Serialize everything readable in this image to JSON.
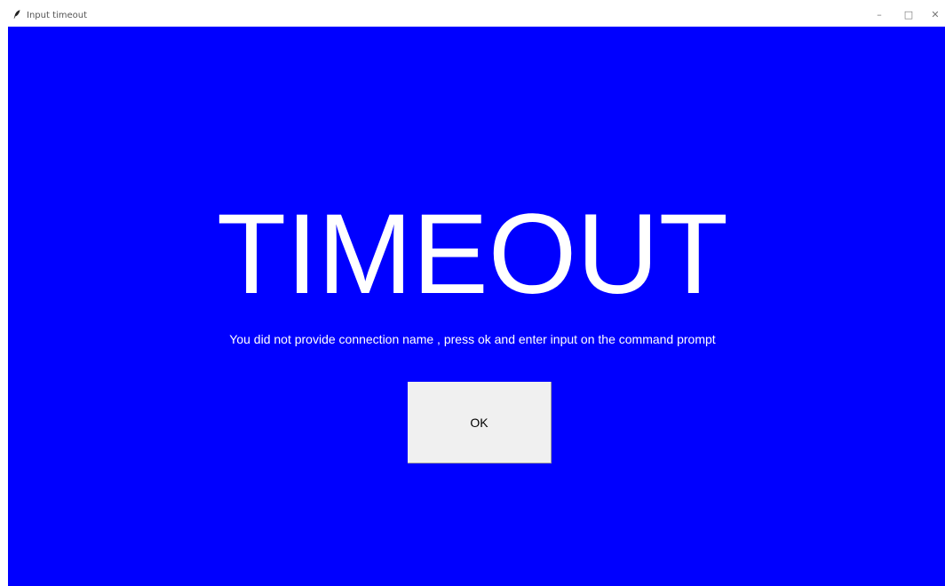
{
  "window": {
    "title": "Input timeout",
    "controls": {
      "minimize": "–",
      "maximize": "□",
      "close": "✕"
    },
    "icon": "feather-icon"
  },
  "dialog": {
    "heading": "TIMEOUT",
    "message": "You did not provide connection name , press ok and enter input on the command prompt",
    "ok_label": "OK"
  },
  "colors": {
    "background": "#0000ff",
    "text": "#ffffff",
    "button": "#f0f0f0"
  }
}
